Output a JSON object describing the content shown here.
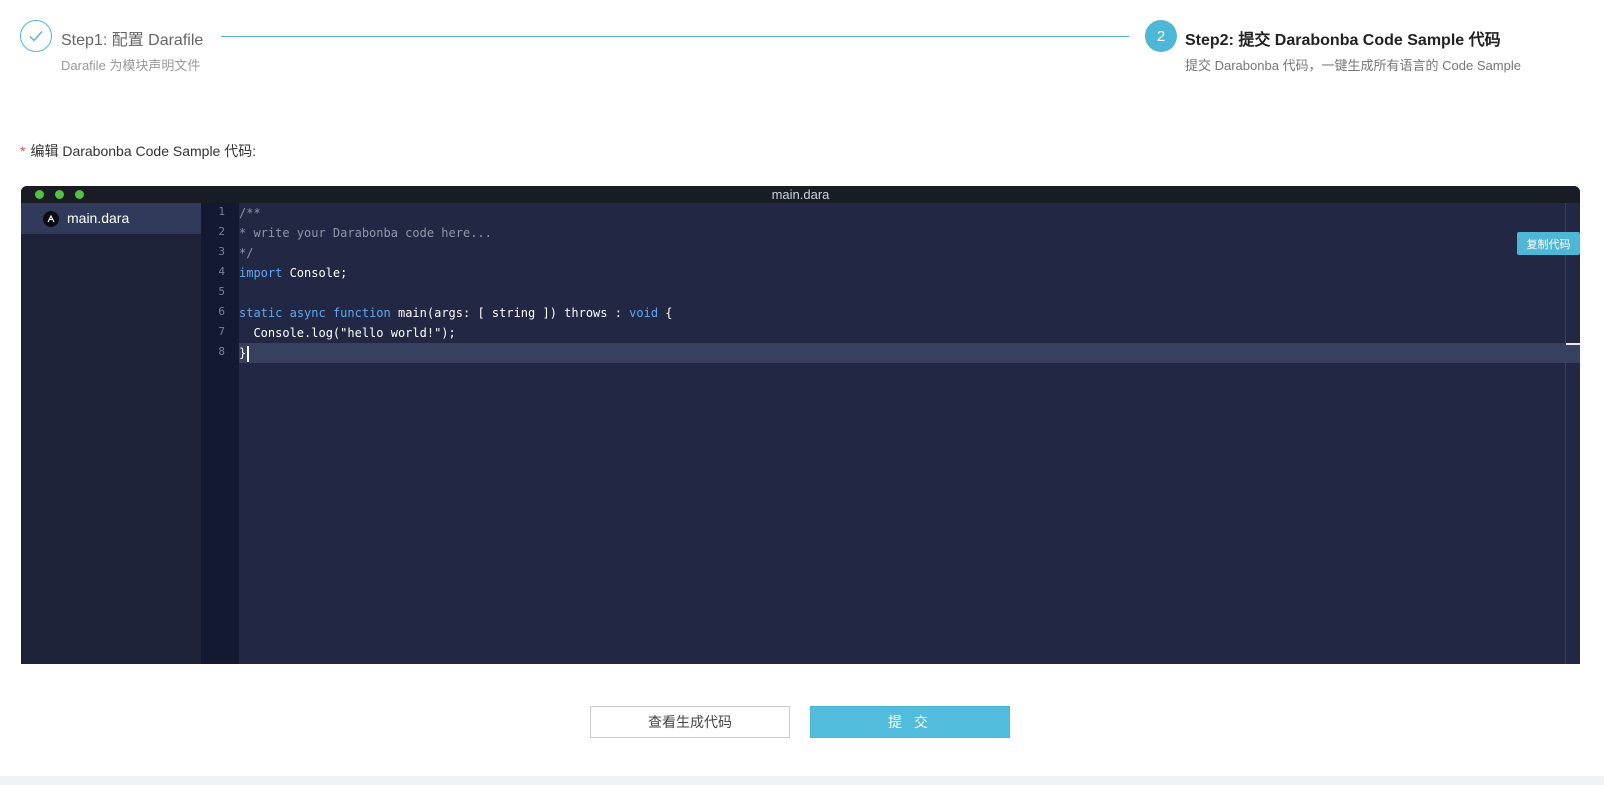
{
  "steps": {
    "step1": {
      "title": "Step1: 配置 Darafile",
      "description": "Darafile 为模块声明文件",
      "status": "done"
    },
    "step2": {
      "number": "2",
      "title": "Step2: 提交 Darabonba Code Sample 代码",
      "description": "提交 Darabonba 代码，一键生成所有语言的 Code Sample",
      "status": "active"
    }
  },
  "form": {
    "required_mark": "*",
    "label": "编辑 Darabonba Code Sample 代码:"
  },
  "editor": {
    "window_title": "main.dara",
    "files": [
      {
        "name": "main.dara",
        "icon": "darabonba-logo-icon",
        "selected": true
      }
    ],
    "copy_button_label": "复制代码",
    "line_numbers": [
      "1",
      "2",
      "3",
      "4",
      "5",
      "6",
      "7",
      "8"
    ],
    "active_line": 8,
    "code": {
      "l1": "/**",
      "l2": "* write your Darabonba code here...",
      "l3": "*/",
      "l4_kw": "import",
      "l4_rest": " Console;",
      "l6_kw1": "static",
      "l6_sp1": " ",
      "l6_kw2": "async",
      "l6_sp2": " ",
      "l6_kw3": "function",
      "l6_mid": " main(args: [ string ]) throws : ",
      "l6_kw4": "void",
      "l6_end": " {",
      "l7": "  Console.log(\"hello world!\");",
      "l8": "}"
    }
  },
  "actions": {
    "preview_label": "查看生成代码",
    "submit_label": "提 交"
  },
  "colors": {
    "accent": "#4fb7d6",
    "editor_bg": "#222744",
    "keyword": "#5fa8f0",
    "comment": "#9097a8"
  }
}
